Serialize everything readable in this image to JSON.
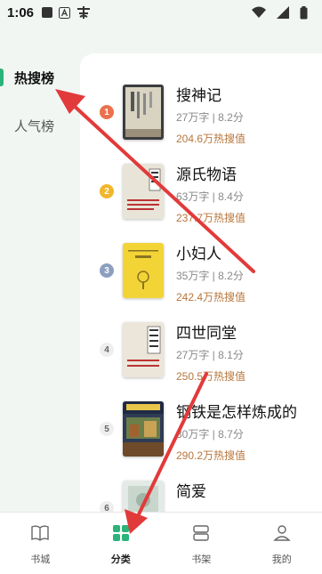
{
  "status_bar": {
    "time": "1:06",
    "icons": [
      "gallery-icon",
      "a-icon",
      "app-icon",
      "wifi-icon",
      "signal-icon",
      "battery-icon"
    ]
  },
  "sidebar": {
    "items": [
      {
        "label": "热搜榜",
        "active": true
      },
      {
        "label": "人气榜",
        "active": false
      }
    ]
  },
  "books": [
    {
      "rank": "1",
      "title": "搜神记",
      "meta": "27万字 | 8.2分",
      "hot": "204.6万热搜值"
    },
    {
      "rank": "2",
      "title": "源氏物语",
      "meta": "63万字 | 8.4分",
      "hot": "237.7万热搜值"
    },
    {
      "rank": "3",
      "title": "小妇人",
      "meta": "35万字 | 8.2分",
      "hot": "242.4万热搜值"
    },
    {
      "rank": "4",
      "title": "四世同堂",
      "meta": "27万字 | 8.1分",
      "hot": "250.5万热搜值"
    },
    {
      "rank": "5",
      "title": "钢铁是怎样炼成的",
      "meta": "30万字 | 8.7分",
      "hot": "290.2万热搜值"
    },
    {
      "rank": "6",
      "title": "简爱",
      "meta": "",
      "hot": ""
    }
  ],
  "tabs": [
    {
      "label": "书城",
      "active": false
    },
    {
      "label": "分类",
      "active": true
    },
    {
      "label": "书架",
      "active": false
    },
    {
      "label": "我的",
      "active": false
    }
  ],
  "colors": {
    "accent": "#2bb37a",
    "hot": "#b8763b",
    "arrow": "#e23a3a"
  }
}
